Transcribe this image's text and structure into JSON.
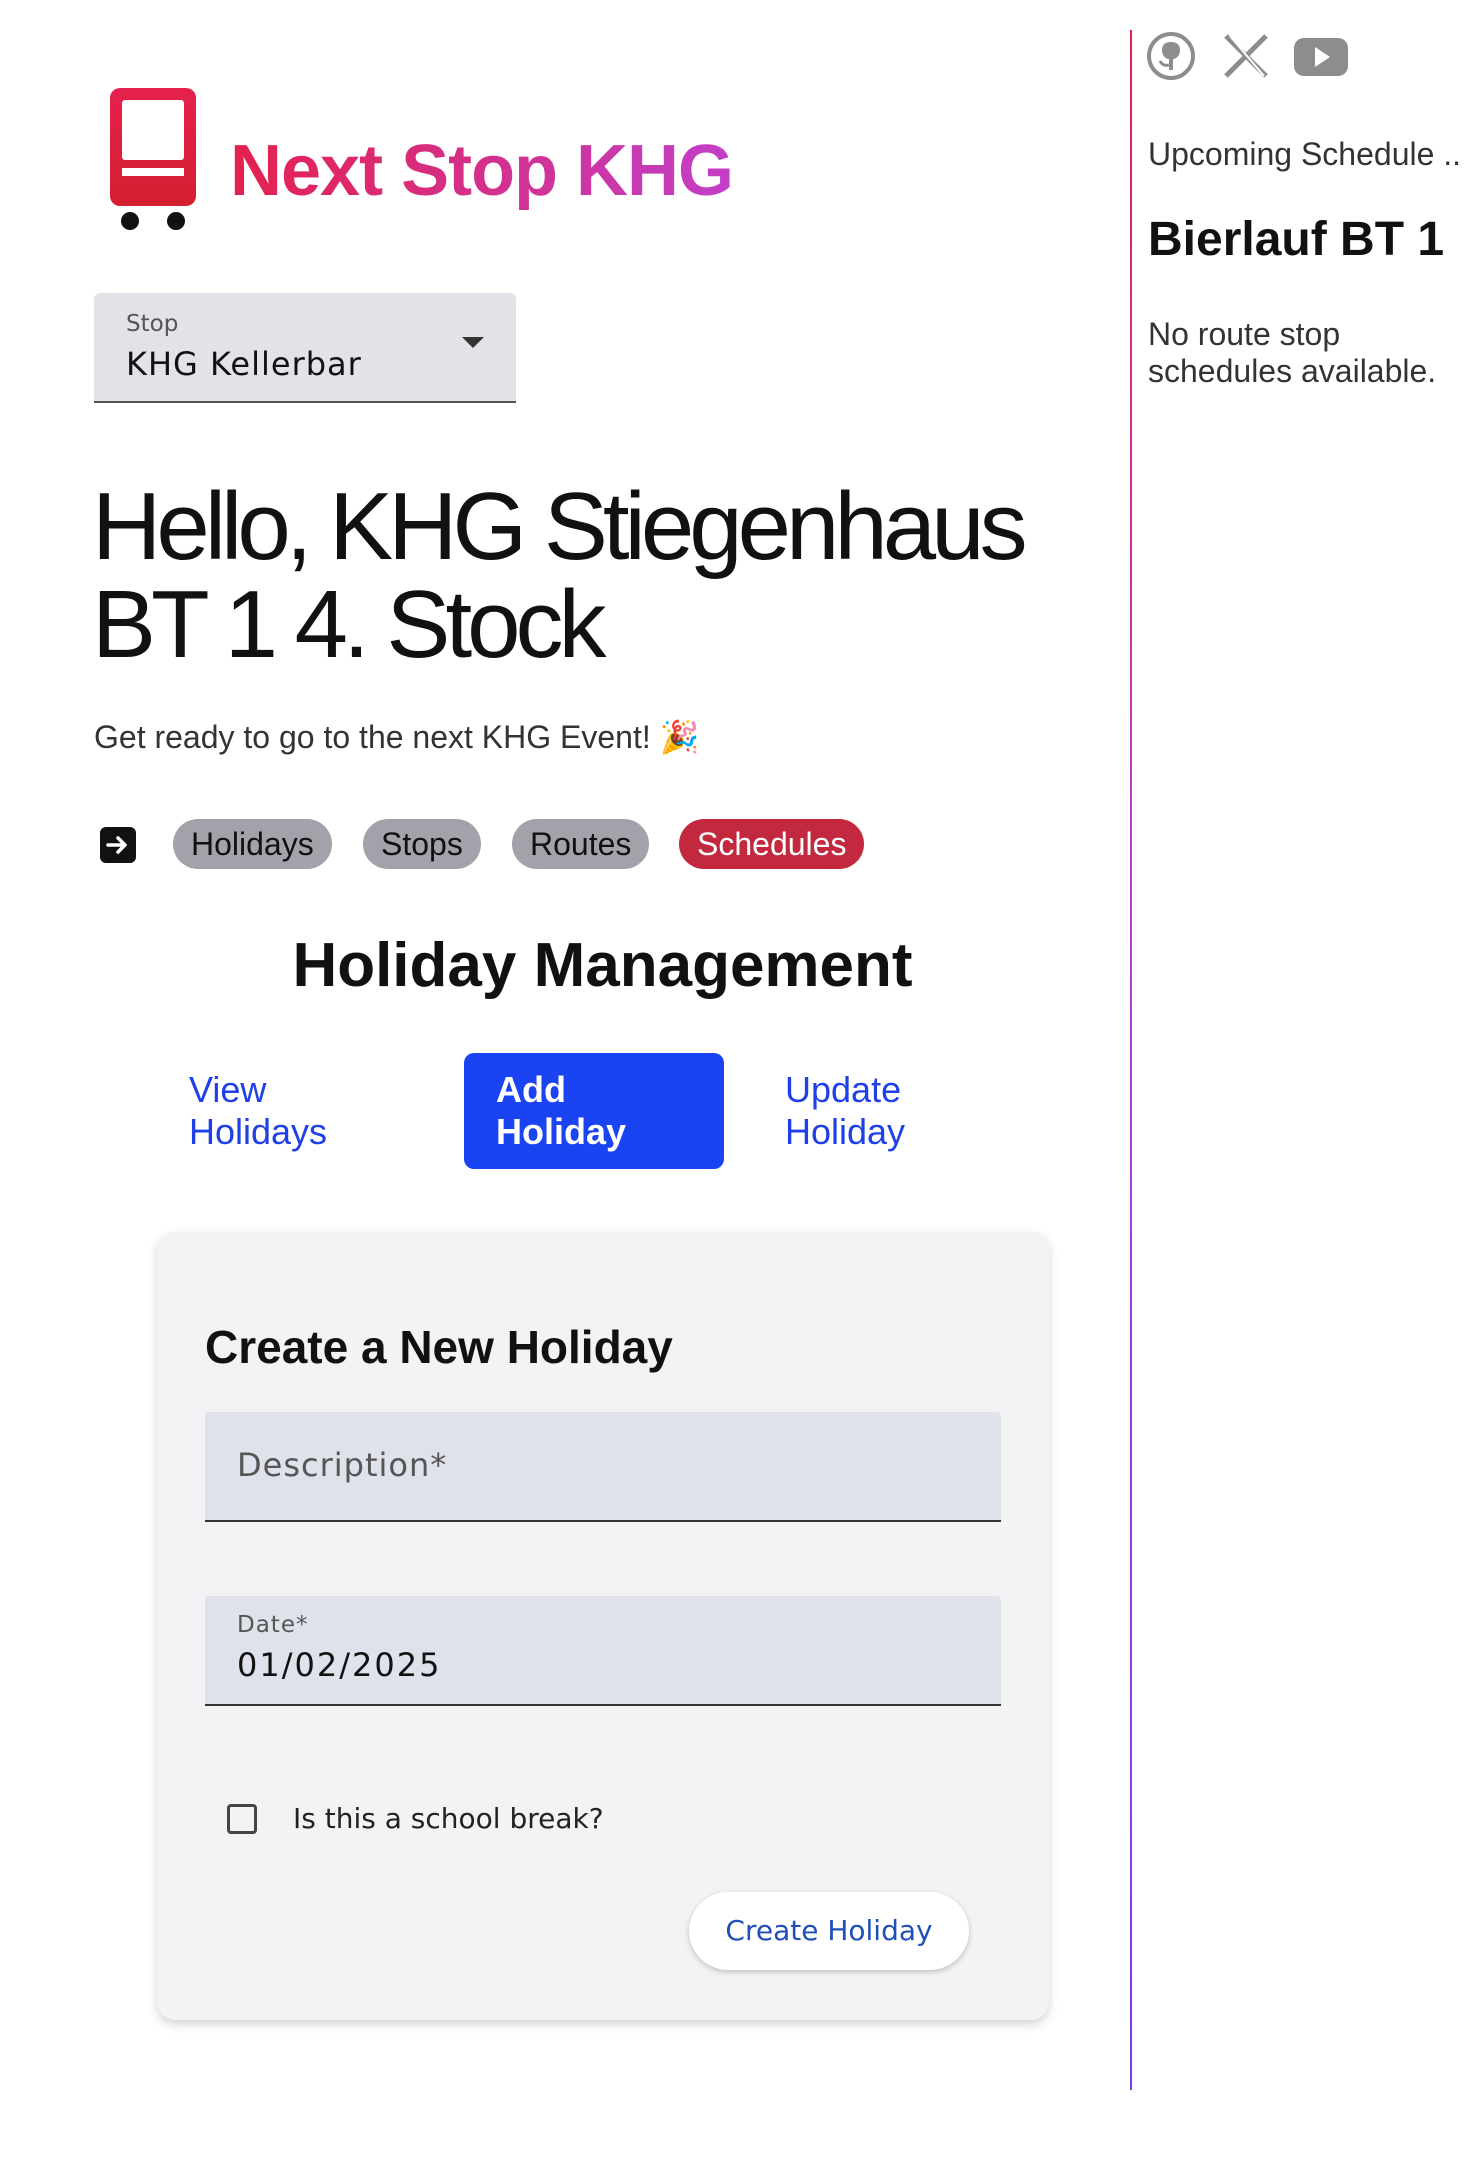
{
  "brand": {
    "title": "Next Stop KHG",
    "logo_icon": "bus-icon",
    "accent_start": "#e5214d",
    "accent_end": "#c23fc9"
  },
  "stop_select": {
    "label": "Stop",
    "value": "KHG Kellerbar"
  },
  "greeting": {
    "title": "Hello, KHG Stiegenhaus BT 1 4. Stock",
    "tagline": "Get ready to go to the next KHG Event! 🎉"
  },
  "nav": {
    "logout_icon": "logout-icon",
    "pills": [
      {
        "label": "Holidays",
        "active": false
      },
      {
        "label": "Stops",
        "active": false
      },
      {
        "label": "Routes",
        "active": false
      },
      {
        "label": "Schedules",
        "active": true
      }
    ],
    "active_color": "#c2293e",
    "inactive_color": "#a3a2ab"
  },
  "section": {
    "title": "Holiday Management"
  },
  "tabs": [
    {
      "label_line1": "View",
      "label_line2": "Holidays",
      "active": false
    },
    {
      "label_line1": "Add",
      "label_line2": "Holiday",
      "active": true
    },
    {
      "label_line1": "Update",
      "label_line2": "Holiday",
      "active": false
    }
  ],
  "form": {
    "title": "Create a New Holiday",
    "description": {
      "placeholder": "Description*"
    },
    "date": {
      "label": "Date*",
      "value": "01/02/2025"
    },
    "school_break": {
      "label": "Is this a school break?",
      "checked": false
    },
    "submit_label": "Create Holiday"
  },
  "sidebar": {
    "social_icons": [
      "github-icon",
      "x-icon",
      "youtube-icon"
    ],
    "upcoming_label": "Upcoming Schedule ..",
    "route_title": "Bierlauf BT 1",
    "empty_message": "No route stop schedules available."
  }
}
